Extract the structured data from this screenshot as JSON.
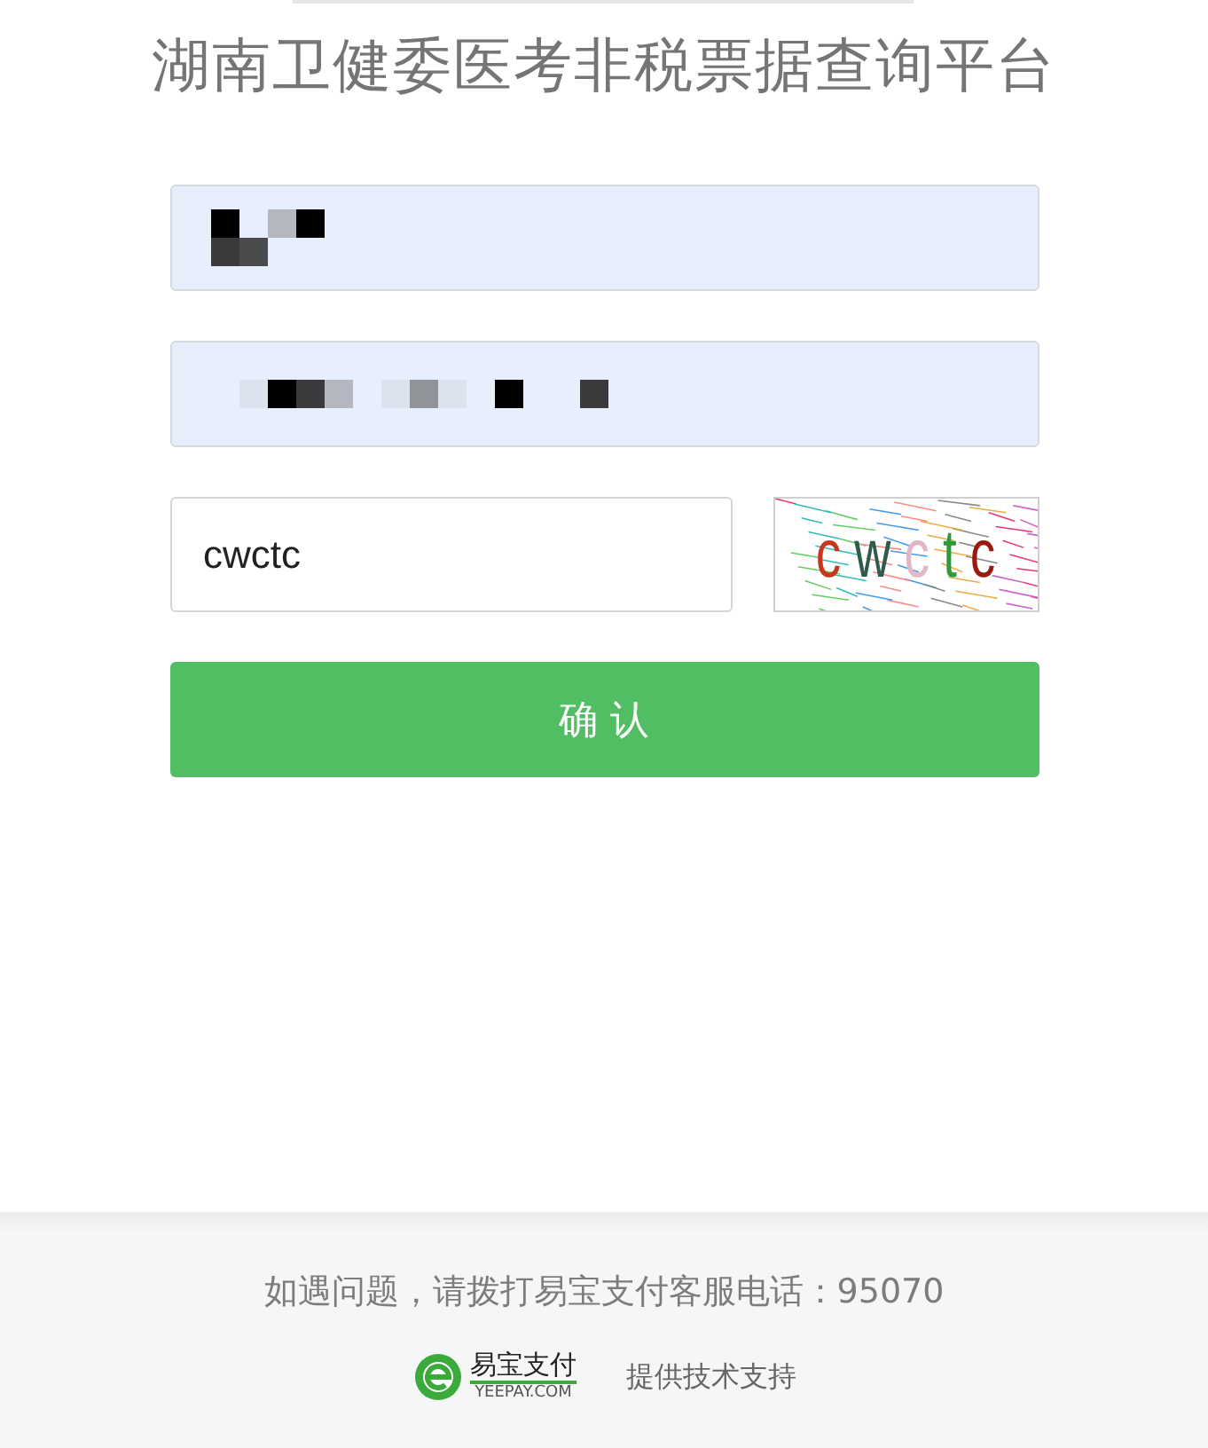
{
  "title": "湖南卫健委医考非税票据查询平台",
  "fields": [
    {
      "kind": "masked"
    },
    {
      "kind": "masked"
    }
  ],
  "captcha": {
    "value": "cwctc",
    "image_text": "cwctc"
  },
  "submit": {
    "label": "确 认"
  },
  "footer": {
    "notice": "如遇问题，请拨打易宝支付客服电话：95070",
    "logo_name": "易宝支付",
    "logo_domain": "YEEPAY.COM",
    "support": "提供技术支持"
  }
}
